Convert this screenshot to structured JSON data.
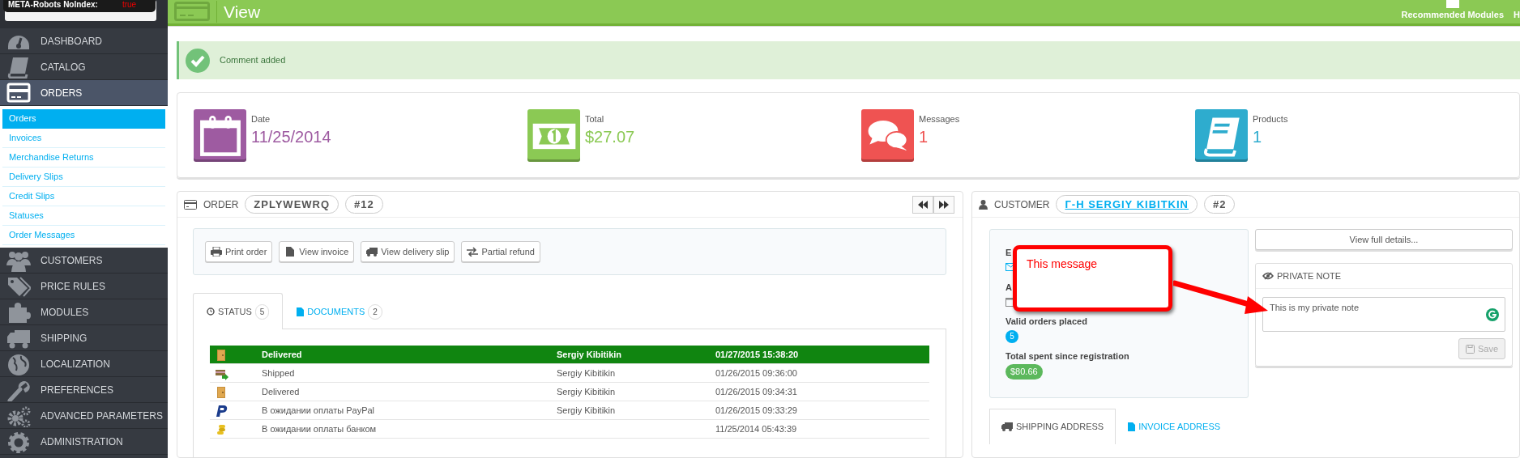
{
  "tooltip": {
    "label": "META-Robots NoIndex:",
    "value": "true"
  },
  "sidebar": {
    "items": [
      {
        "label": "DASHBOARD",
        "selected": false
      },
      {
        "label": "CATALOG",
        "selected": false
      },
      {
        "label": "ORDERS",
        "selected": true,
        "children": [
          {
            "label": "Orders",
            "selected": true
          },
          {
            "label": "Invoices",
            "selected": false
          },
          {
            "label": "Merchandise Returns",
            "selected": false
          },
          {
            "label": "Delivery Slips",
            "selected": false
          },
          {
            "label": "Credit Slips",
            "selected": false
          },
          {
            "label": "Statuses",
            "selected": false
          },
          {
            "label": "Order Messages",
            "selected": false
          }
        ]
      },
      {
        "label": "CUSTOMERS",
        "selected": false
      },
      {
        "label": "PRICE RULES",
        "selected": false
      },
      {
        "label": "MODULES",
        "selected": false
      },
      {
        "label": "SHIPPING",
        "selected": false
      },
      {
        "label": "LOCALIZATION",
        "selected": false
      },
      {
        "label": "PREFERENCES",
        "selected": false
      },
      {
        "label": "ADVANCED PARAMETERS",
        "selected": false
      },
      {
        "label": "ADMINISTRATION",
        "selected": false
      }
    ]
  },
  "header": {
    "title": "View",
    "toolbar": [
      {
        "label": "Recommended Modules"
      },
      {
        "label": "H"
      }
    ]
  },
  "alert": {
    "text": "Comment added"
  },
  "kpis": [
    {
      "kind": "date",
      "label": "Date",
      "value": "11/25/2014",
      "color": "#9e5ba1"
    },
    {
      "kind": "total",
      "label": "Total",
      "value": "$27.07",
      "color": "#8bc954"
    },
    {
      "kind": "messages",
      "label": "Messages",
      "value": "1",
      "color": "#ef5352"
    },
    {
      "kind": "products",
      "label": "Products",
      "value": "1",
      "color": "#2eacce"
    }
  ],
  "order": {
    "title": "ORDER",
    "reference": "ZPLYWEWRQ",
    "number": "#12",
    "actions": [
      "Print order",
      "View invoice",
      "View delivery slip",
      "Partial refund"
    ],
    "tabs": [
      {
        "label": "STATUS",
        "count": "5",
        "selected": true
      },
      {
        "label": "DOCUMENTS",
        "count": "2",
        "selected": false
      }
    ],
    "history": [
      {
        "kind": "delivered",
        "status": "Delivered",
        "employee": "Sergiy Kibitikin",
        "date": "01/27/2015 15:38:20",
        "selected": true
      },
      {
        "kind": "shipped",
        "status": "Shipped",
        "employee": "Sergiy Kibitikin",
        "date": "01/26/2015 09:36:00",
        "selected": false
      },
      {
        "kind": "delivered",
        "status": "Delivered",
        "employee": "Sergiy Kibitikin",
        "date": "01/26/2015 09:34:31",
        "selected": false
      },
      {
        "kind": "paypal",
        "status": "В ожидании оплаты PayPal",
        "employee": "Sergiy Kibitikin",
        "date": "01/26/2015 09:33:29",
        "selected": false
      },
      {
        "kind": "bank",
        "status": "В ожидании оплаты банком",
        "date": "11/25/2014 05:43:39",
        "selected": false
      }
    ]
  },
  "customer": {
    "title": "CUSTOMER",
    "name": "Г-Н SERGIY KIBITKIN",
    "number": "#2",
    "fields": [
      {
        "kind": "email",
        "label": "E"
      },
      {
        "kind": "date",
        "label": "A"
      },
      {
        "kind": "count",
        "label": "Valid orders placed",
        "value": "5"
      },
      {
        "kind": "amount",
        "label": "Total spent since registration",
        "value": "$80.66"
      }
    ],
    "details_button": "View full details...",
    "private_note": {
      "title": "PRIVATE NOTE",
      "value": "This is my private note",
      "save": "Save",
      "save_disabled": true
    },
    "address_tabs": [
      {
        "label": "SHIPPING ADDRESS",
        "selected": true
      },
      {
        "label": "INVOICE ADDRESS",
        "selected": false
      }
    ]
  },
  "callout": {
    "text": "This message"
  }
}
